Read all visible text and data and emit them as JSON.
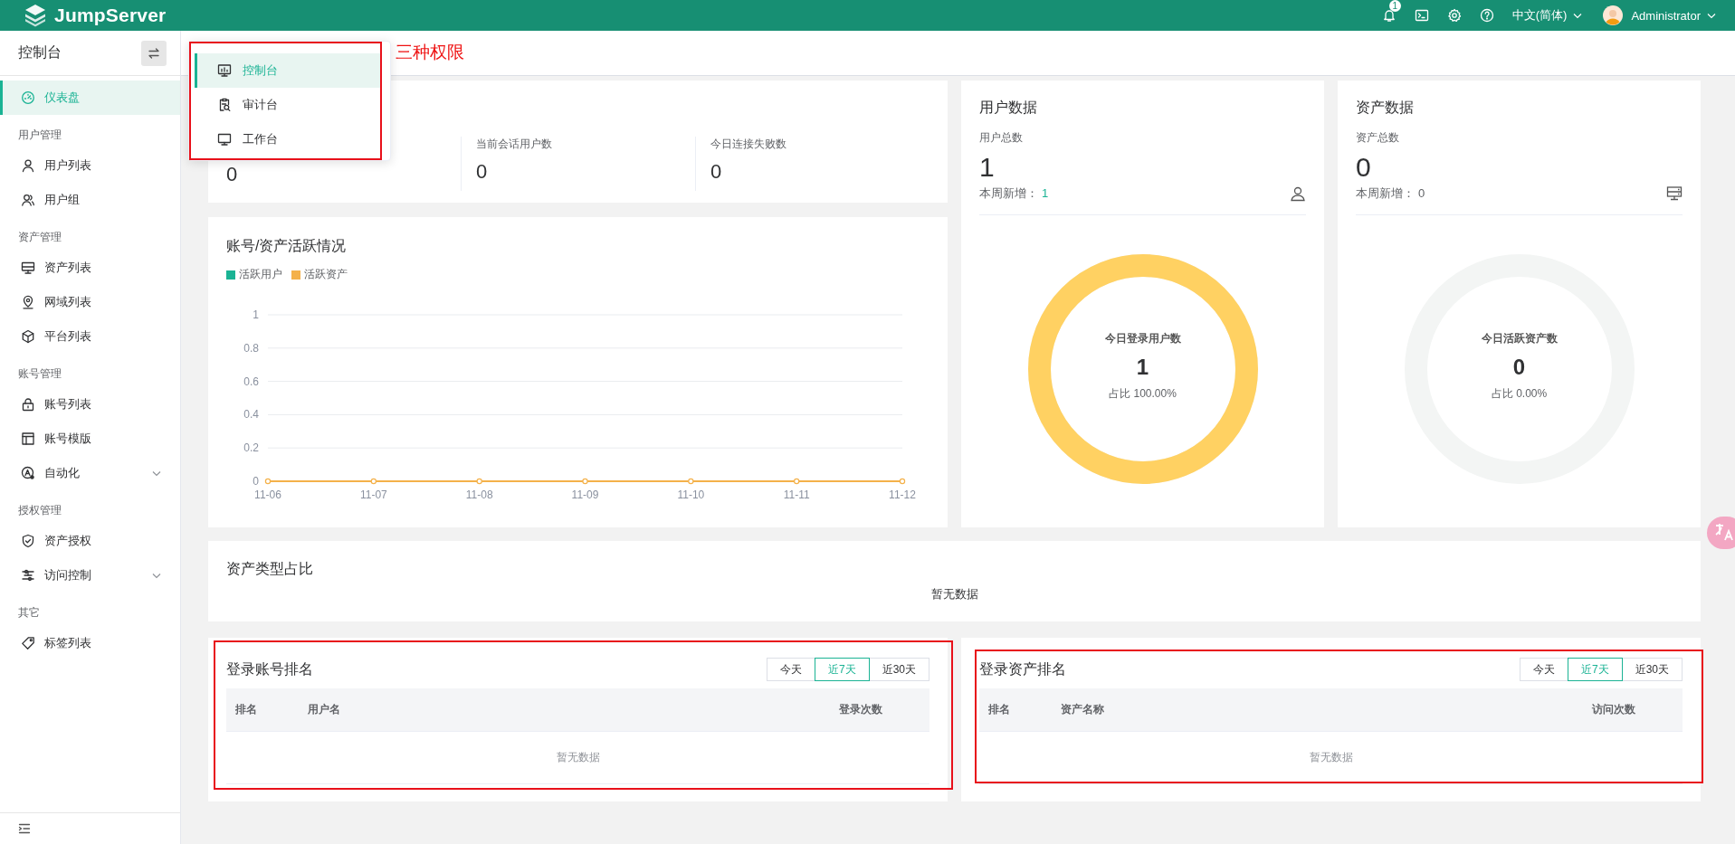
{
  "topbar": {
    "logo_text": "JumpServer",
    "notification_count": "1",
    "language": "中文(简体)",
    "user": "Administrator"
  },
  "sidebar": {
    "title": "控制台",
    "items": [
      {
        "kind": "item",
        "label": "仪表盘",
        "selected": true
      },
      {
        "kind": "group",
        "label": "用户管理"
      },
      {
        "kind": "item",
        "label": "用户列表",
        "selected": false
      },
      {
        "kind": "item",
        "label": "用户组",
        "selected": false
      },
      {
        "kind": "group",
        "label": "资产管理"
      },
      {
        "kind": "item",
        "label": "资产列表",
        "selected": false
      },
      {
        "kind": "item",
        "label": "网域列表",
        "selected": false
      },
      {
        "kind": "item",
        "label": "平台列表",
        "selected": false
      },
      {
        "kind": "group",
        "label": "账号管理"
      },
      {
        "kind": "item",
        "label": "账号列表",
        "selected": false
      },
      {
        "kind": "item",
        "label": "账号模版",
        "selected": false
      },
      {
        "kind": "item",
        "label": "自动化",
        "selected": false,
        "expanded": false
      },
      {
        "kind": "group",
        "label": "授权管理"
      },
      {
        "kind": "item",
        "label": "资产授权",
        "selected": false
      },
      {
        "kind": "item",
        "label": "访问控制",
        "selected": false,
        "expanded": false
      },
      {
        "kind": "group",
        "label": "其它"
      },
      {
        "kind": "item",
        "label": "标签列表",
        "selected": false
      }
    ]
  },
  "console_menu": {
    "highlighted": true,
    "items": [
      {
        "label": "控制台",
        "selected": true
      },
      {
        "label": "审计台",
        "selected": false
      },
      {
        "label": "工作台",
        "selected": false
      }
    ]
  },
  "annotation": {
    "text": "三种权限"
  },
  "stats_card": {
    "items": [
      {
        "value": "0"
      },
      {
        "label": "当前会话用户数",
        "value": "0"
      },
      {
        "label": "今日连接失败数",
        "value": "0"
      }
    ]
  },
  "activity_card": {
    "title": "账号/资产活跃情况",
    "chart_data": {
      "type": "line",
      "categories": [
        "11-06",
        "11-07",
        "11-08",
        "11-09",
        "11-10",
        "11-11",
        "11-12"
      ],
      "series": [
        {
          "name": "活跃用户",
          "color": "#1ab394",
          "marker": true,
          "values": [
            null,
            null,
            null,
            null,
            null,
            null,
            null
          ]
        },
        {
          "name": "活跃资产",
          "color": "#f4b14a",
          "marker": true,
          "values": [
            0,
            0,
            0,
            0,
            0,
            0,
            0
          ]
        }
      ],
      "grid": true,
      "ylim": [
        0,
        1
      ],
      "yticks": [
        0,
        0.2,
        0.4,
        0.6,
        0.8,
        1
      ]
    }
  },
  "summary_cards": [
    {
      "kind": "user",
      "title": "用户数据",
      "total_label": "用户总数",
      "total": "1",
      "weekly_label": "本周新增：",
      "weekly_value": "1",
      "ring": {
        "label": "今日登录用户数",
        "value": "1",
        "ratio": "占比 100.00%",
        "level": 1
      }
    },
    {
      "kind": "asset",
      "title": "资产数据",
      "total_label": "资产总数",
      "total": "0",
      "weekly_label": "本周新增：",
      "weekly_value": "0",
      "ring": {
        "label": "今日活跃资产数",
        "value": "0",
        "ratio": "占比 0.00%",
        "level": 0
      }
    }
  ],
  "asset_type_card": {
    "title": "资产类型占比",
    "empty_text": "暂无数据"
  },
  "rankings": [
    {
      "title": "登录账号排名",
      "highlighted": true,
      "periods": [
        {
          "label": "今天",
          "selected": false
        },
        {
          "label": "近7天",
          "selected": true
        },
        {
          "label": "近30天",
          "selected": false
        }
      ],
      "columns": [
        "排名",
        "用户名",
        "登录次数"
      ],
      "empty_text": "暂无数据"
    },
    {
      "title": "登录资产排名",
      "highlighted": true,
      "periods": [
        {
          "label": "今天",
          "selected": false
        },
        {
          "label": "近7天",
          "selected": true
        },
        {
          "label": "近30天",
          "selected": false
        }
      ],
      "columns": [
        "排名",
        "资产名称",
        "访问次数"
      ],
      "empty_text": "暂无数据"
    }
  ]
}
